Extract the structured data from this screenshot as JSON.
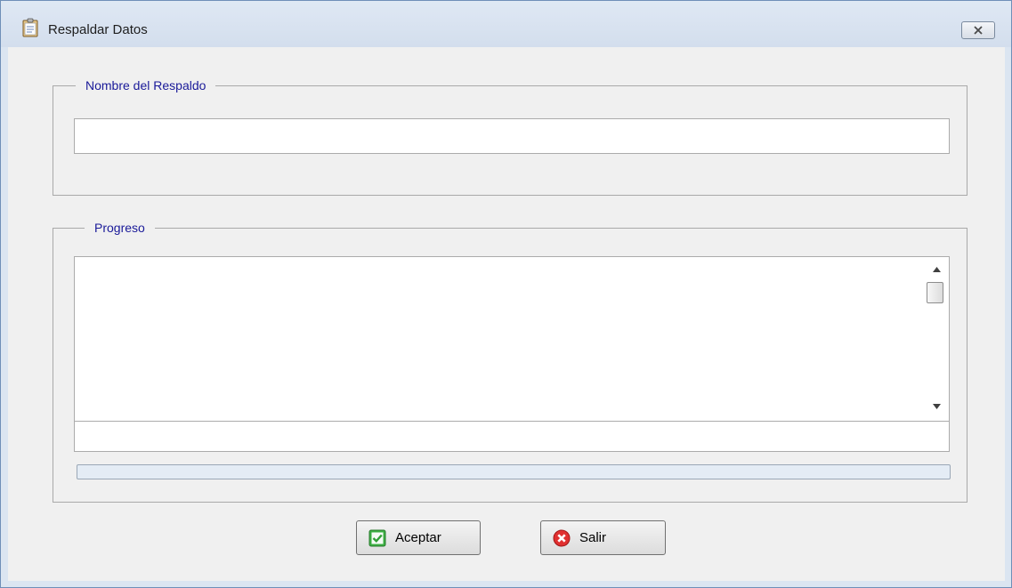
{
  "window": {
    "title": "Respaldar Datos",
    "icon": "clipboard-icon",
    "close_icon": "close-icon"
  },
  "groups": {
    "backup_name": {
      "legend": "Nombre del Respaldo",
      "input_value": "",
      "input_placeholder": ""
    },
    "progress": {
      "legend": "Progreso",
      "log_text": "",
      "status_text": "",
      "progress_value": 0
    }
  },
  "buttons": {
    "accept": {
      "label": "Aceptar",
      "icon": "check-icon",
      "color": "#3cb043"
    },
    "exit": {
      "label": "Salir",
      "icon": "cancel-icon",
      "color": "#e03030"
    }
  }
}
